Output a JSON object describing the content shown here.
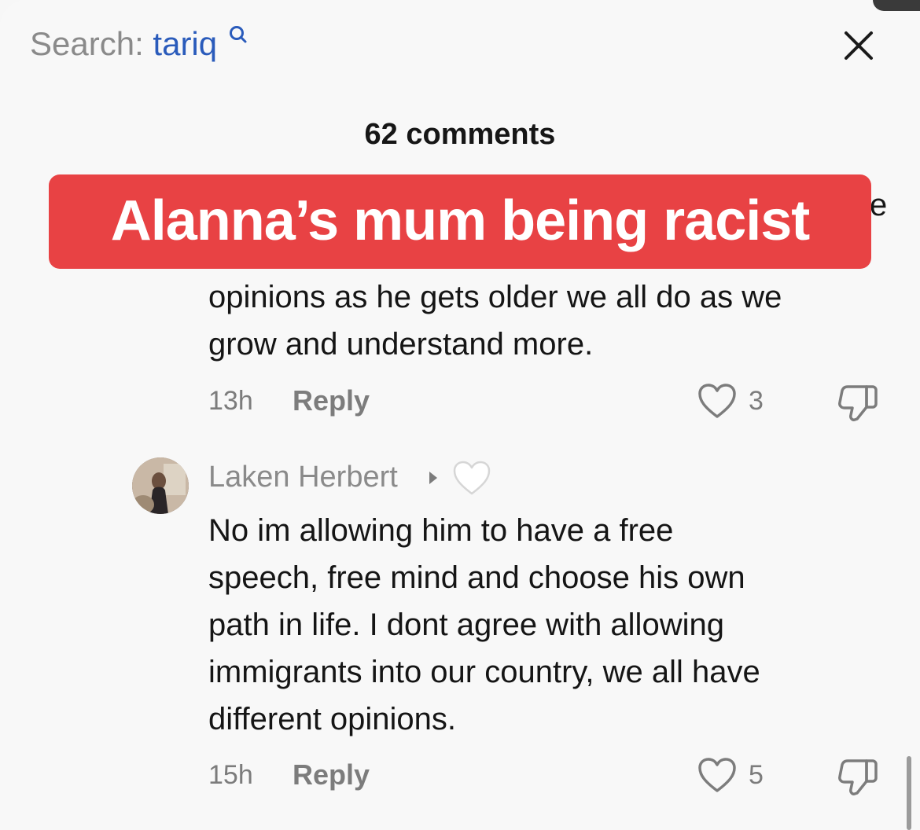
{
  "search": {
    "label": "Search:",
    "query": "tariq"
  },
  "header": {
    "comment_count": "62 comments"
  },
  "overlay": {
    "text": "Alanna’s mum being racist"
  },
  "comments": [
    {
      "partial_tail": "e",
      "lines": [
        "opinions as he gets older we all do as we",
        "grow and understand more."
      ],
      "time": "13h",
      "reply_label": "Reply",
      "likes": "3"
    },
    {
      "username": "Laken Herbert",
      "lines": [
        "No im allowing him to have a free",
        "speech, free mind and choose his own",
        "path in life. I dont agree with allowing",
        "immigrants into our country, we all have",
        "different opinions."
      ],
      "time": "15h",
      "reply_label": "Reply",
      "likes": "5"
    }
  ],
  "icons": {
    "search": "search-icon",
    "close": "close-icon",
    "like": "heart-outline-icon",
    "dislike": "thumbs-down-icon",
    "creator_heart": "white-heart-icon",
    "play": "play-triangle-icon"
  },
  "colors": {
    "overlay_bg": "#e84244",
    "query": "#2a5bbb",
    "meta": "#7c7c7c"
  }
}
